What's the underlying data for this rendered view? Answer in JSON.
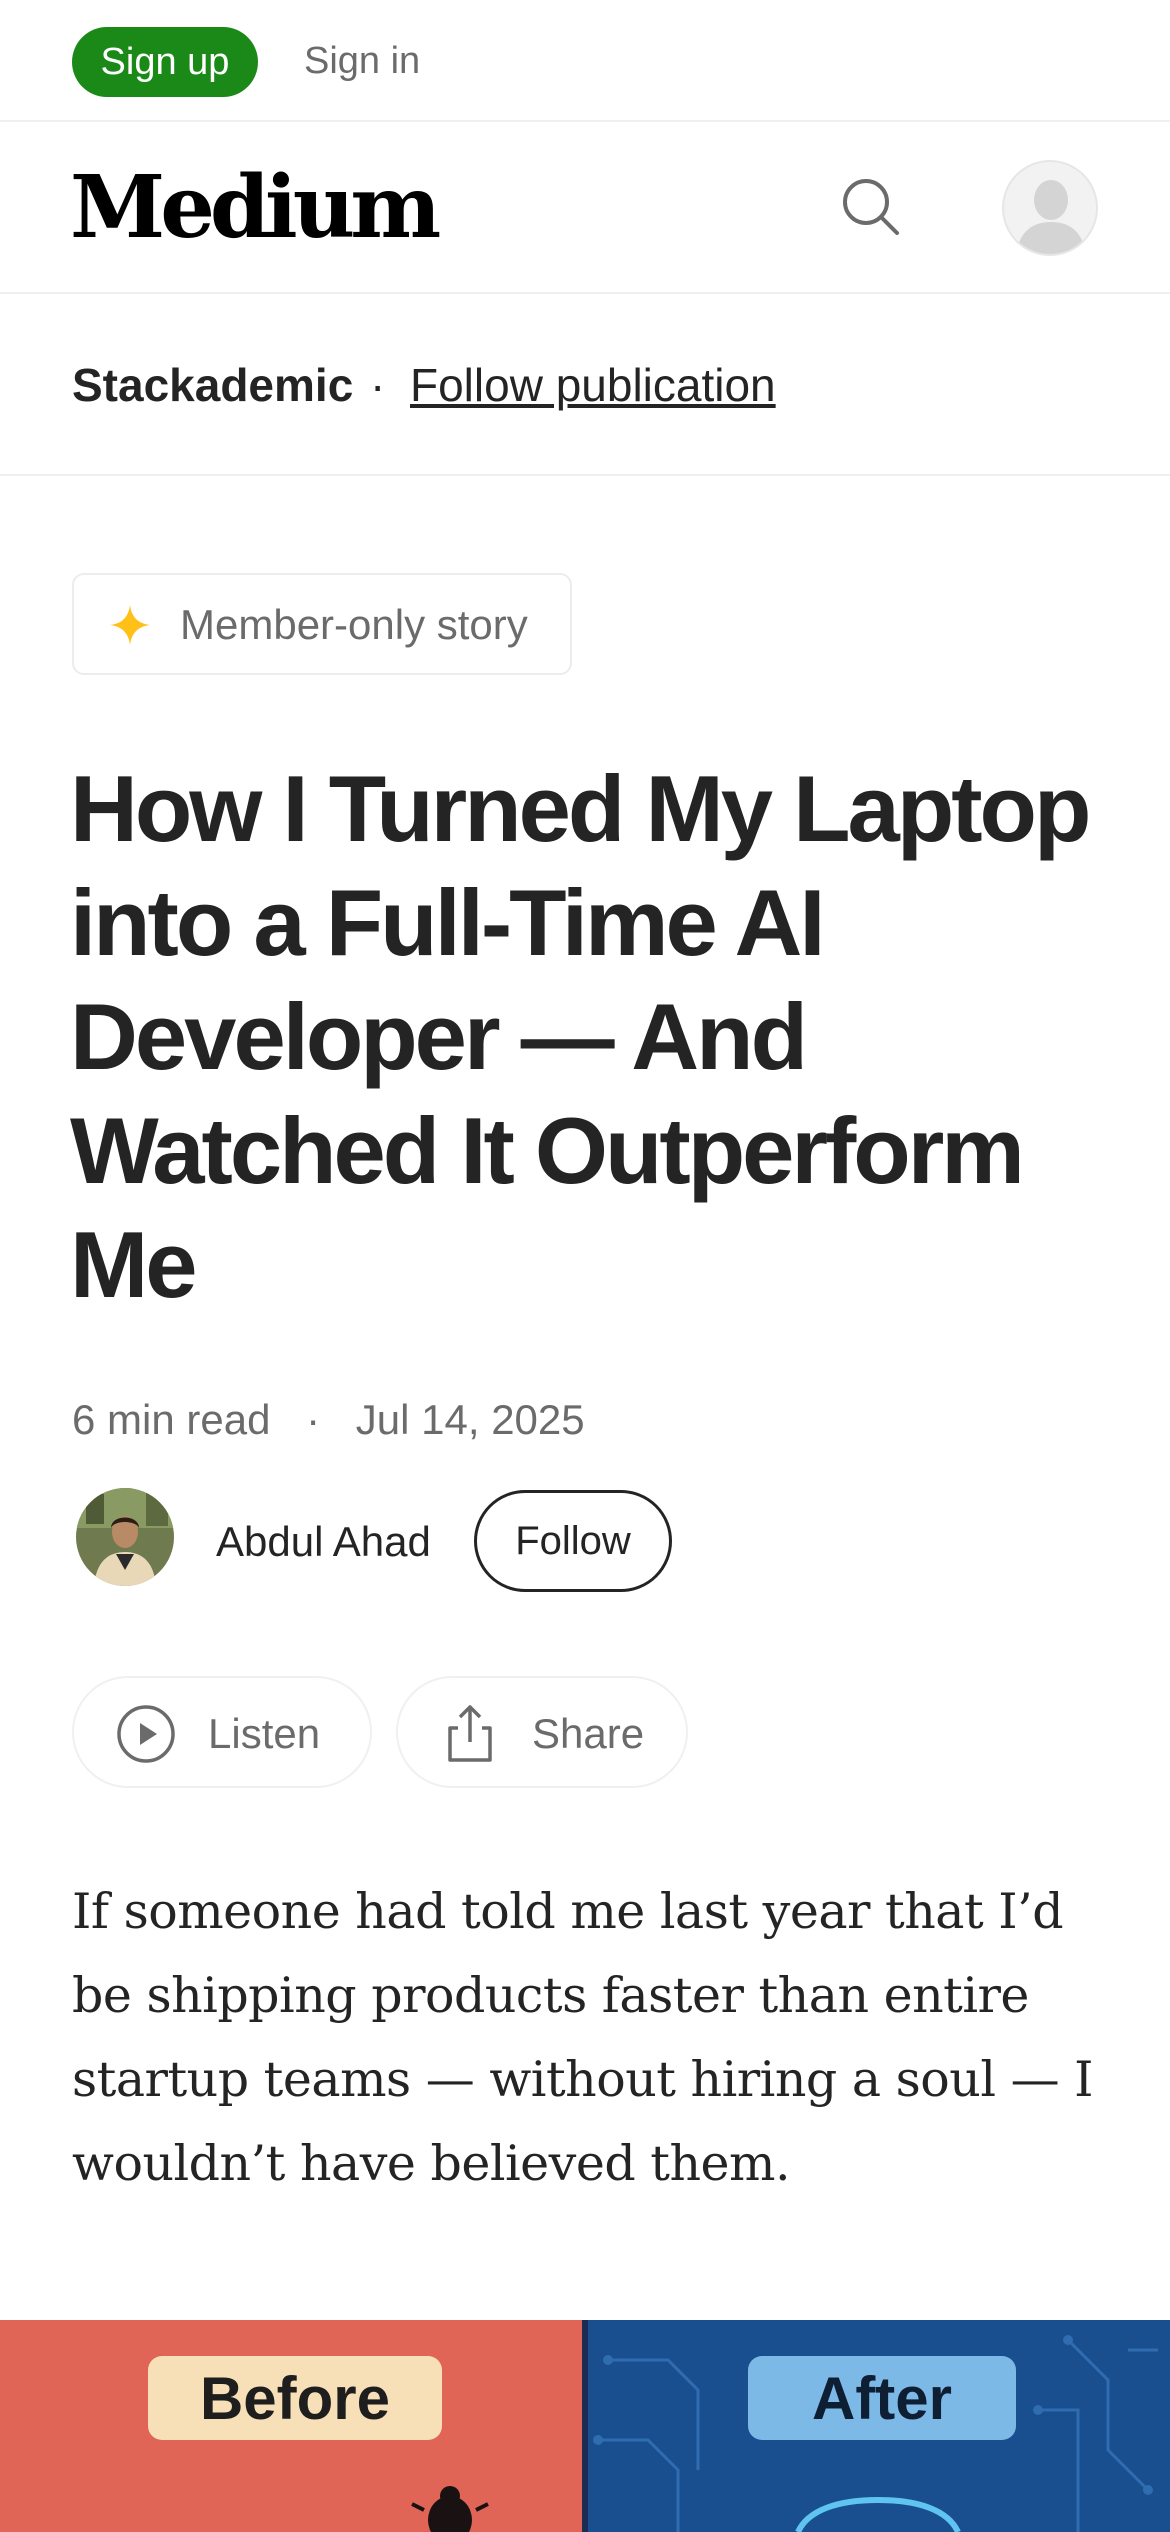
{
  "topbar": {
    "signup_label": "Sign up",
    "signin_label": "Sign in"
  },
  "nav": {
    "logo": "Medium",
    "search_icon": "search-icon",
    "avatar_icon": "user-avatar-icon"
  },
  "publication": {
    "name": "Stackademic",
    "separator": "·",
    "follow_label": "Follow publication"
  },
  "badge": {
    "icon": "star-icon",
    "label": "Member-only story",
    "star_color": "#ffc017"
  },
  "article": {
    "title": "How I Turned My Laptop into a Full-Time AI Developer — And Watched It Outperform Me",
    "read_time": "6 min read",
    "separator": "·",
    "date": "Jul 14, 2025",
    "author": "Abdul Ahad",
    "follow_label": "Follow",
    "listen_label": "Listen",
    "share_label": "Share",
    "intro": "If someone had told me last year that I’d be shipping products faster than entire startup teams — without hiring a soul — I wouldn’t have believed them."
  },
  "hero_image": {
    "before_label": "Before",
    "after_label": "After",
    "left_color": "#e06556",
    "right_color": "#1a4f8f"
  },
  "colors": {
    "accent": "#1a8917",
    "text": "#242424",
    "muted": "#6b6b6b"
  }
}
